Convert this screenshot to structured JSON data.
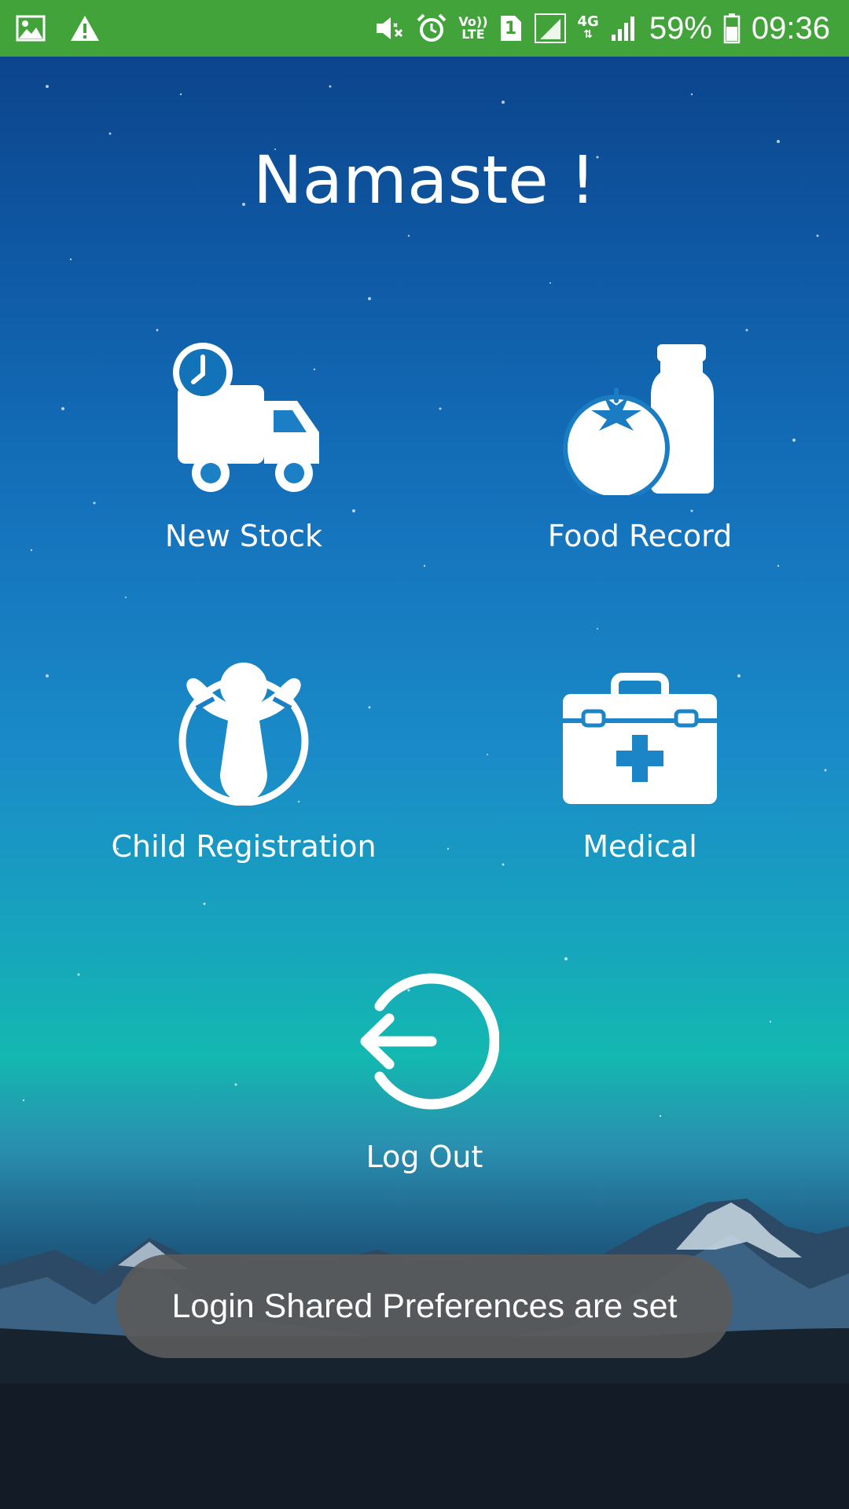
{
  "status_bar": {
    "battery": "59%",
    "time": "09:36",
    "volte_line1": "Vo))",
    "volte_line2": "LTE",
    "sim_slot": "1",
    "network_type": "4G",
    "icons": [
      "gallery-icon",
      "warning-icon",
      "vibrate-mute-icon",
      "alarm-icon",
      "volte-icon",
      "sim-icon",
      "signal-icon",
      "data-4g-icon",
      "signal-icon",
      "battery-icon"
    ],
    "background_color": "#43a33b"
  },
  "greeting": "Namaste !",
  "menu": {
    "new_stock": {
      "label": "New Stock",
      "icon": "delivery-truck-clock-icon"
    },
    "food_record": {
      "label": "Food Record",
      "icon": "tomato-bottle-icon"
    },
    "child_registration": {
      "label": "Child Registration",
      "icon": "child-arms-raised-icon"
    },
    "medical": {
      "label": "Medical",
      "icon": "first-aid-kit-icon"
    },
    "log_out": {
      "label": "Log Out",
      "icon": "logout-arrow-icon"
    }
  },
  "toast": {
    "message": "Login Shared Preferences are set"
  },
  "colors": {
    "icon": "#ffffff",
    "text": "#ffffff",
    "toast_background": "#5a5a5a"
  }
}
